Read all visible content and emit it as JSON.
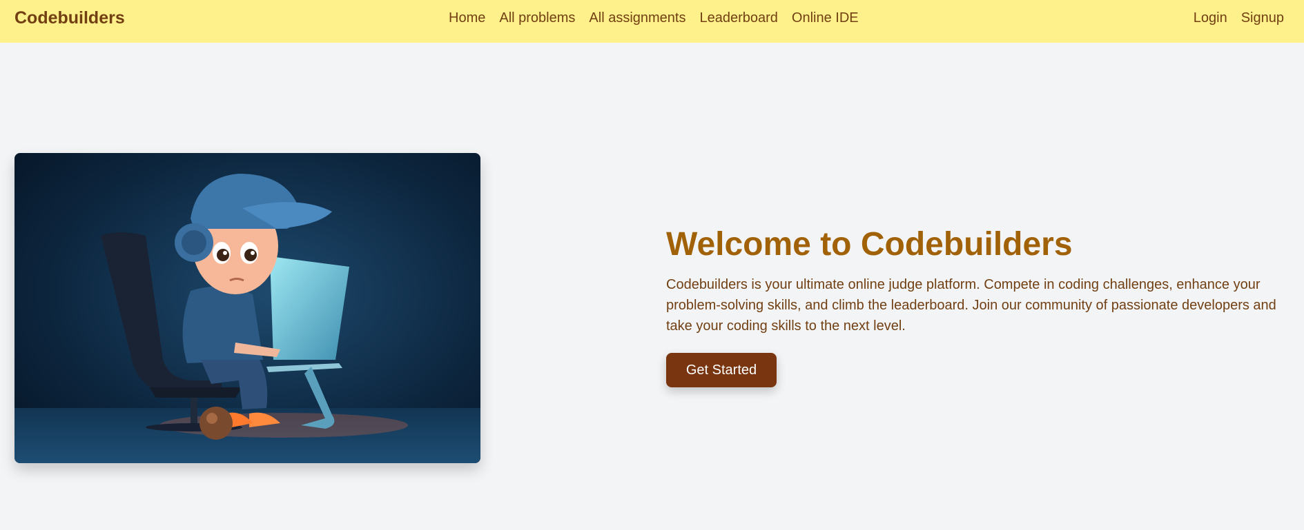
{
  "navbar": {
    "brand": "Codebuilders",
    "links": [
      "Home",
      "All problems",
      "All assignments",
      "Leaderboard",
      "Online IDE"
    ],
    "auth": [
      "Login",
      "Signup"
    ]
  },
  "hero": {
    "title": "Welcome to Codebuilders",
    "description": "Codebuilders is your ultimate online judge platform. Compete in coding challenges, enhance your problem-solving skills, and climb the leaderboard. Join our community of passionate developers and take your coding skills to the next level.",
    "cta_label": "Get Started",
    "image_icon": "coder-illustration"
  },
  "colors": {
    "navbar_bg": "#fef08a",
    "brand_text": "#713f12",
    "title": "#a16207",
    "button_bg": "#78350f",
    "page_bg": "#f3f4f6"
  }
}
